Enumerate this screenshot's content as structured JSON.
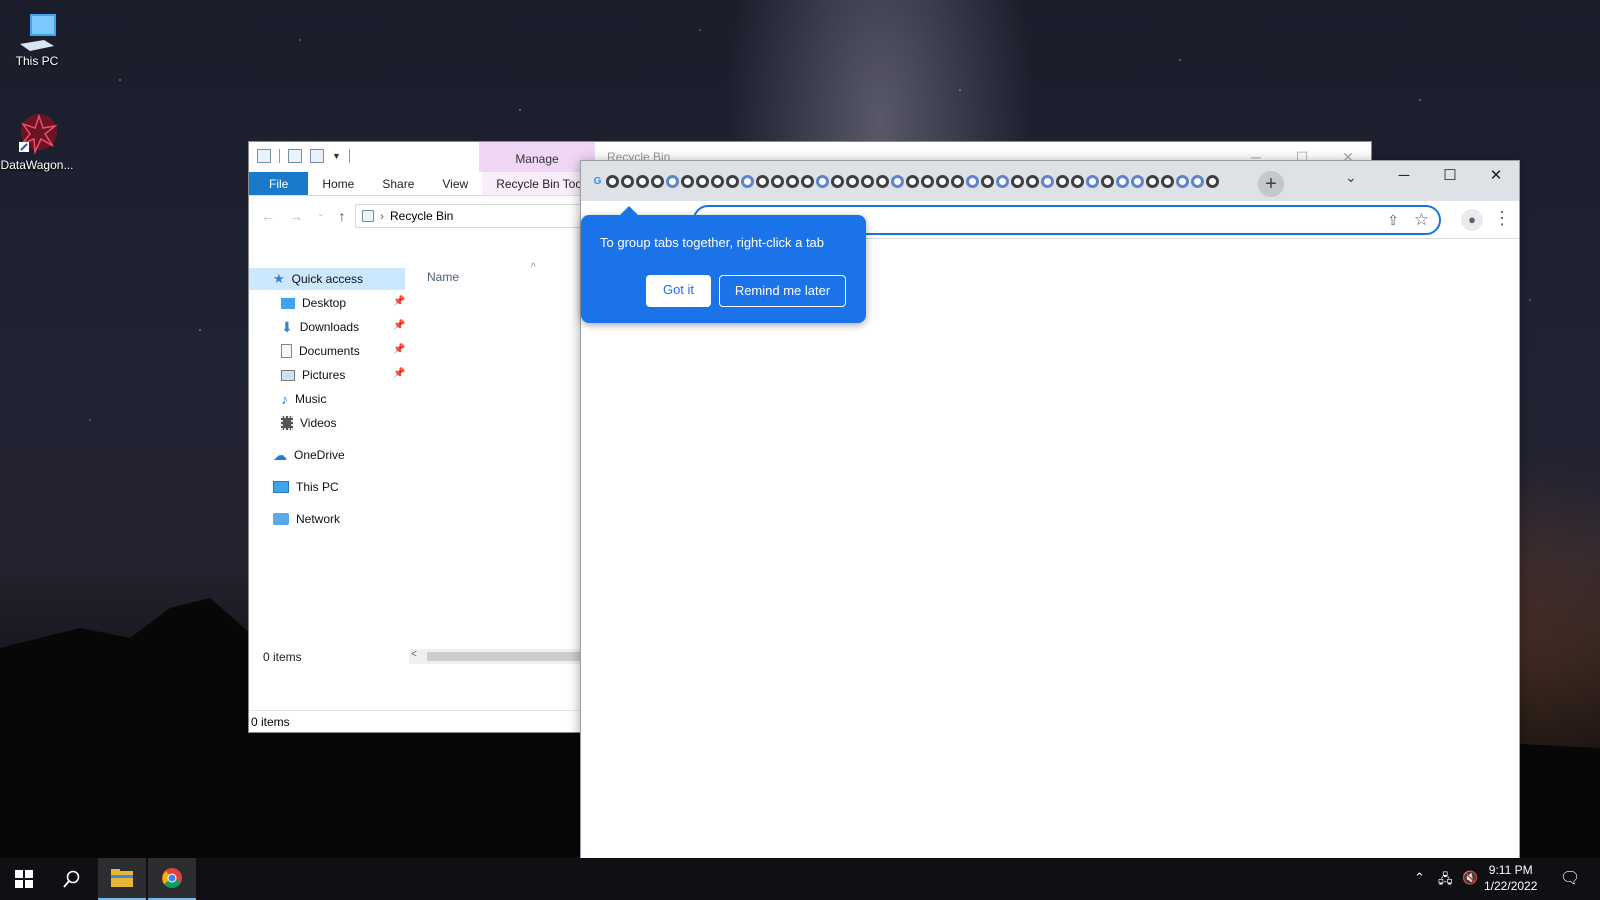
{
  "desktop": {
    "icons": [
      {
        "label": "This PC",
        "icon": "computer-icon"
      },
      {
        "label": "DataWagon...",
        "icon": "datawagon-icon"
      }
    ]
  },
  "explorer": {
    "title": "Recycle Bin",
    "manage_tab": "Manage",
    "ribbon_tabs": [
      "File",
      "Home",
      "Share",
      "View",
      "Recycle Bin Tools"
    ],
    "address": "Recycle Bin",
    "nav": {
      "quick_access": "Quick access",
      "pinned": [
        "Desktop",
        "Downloads",
        "Documents",
        "Pictures"
      ],
      "unpinned": [
        "Music",
        "Videos"
      ],
      "onedrive": "OneDrive",
      "this_pc": "This PC",
      "network": "Network"
    },
    "column_header": "Name",
    "item_count": "0 items",
    "status": "0 items"
  },
  "chrome": {
    "omnibox_value": "",
    "tab_count_shown": 42,
    "bubble": {
      "message": "To group tabs together, right-click a tab",
      "got_it": "Got it",
      "remind_later": "Remind me later"
    },
    "accent": "#1a73e8"
  },
  "taskbar": {
    "time": "9:11 PM",
    "date": "1/22/2022",
    "pinned": [
      "start-icon",
      "search-icon",
      "file-explorer-icon",
      "chrome-icon"
    ]
  }
}
